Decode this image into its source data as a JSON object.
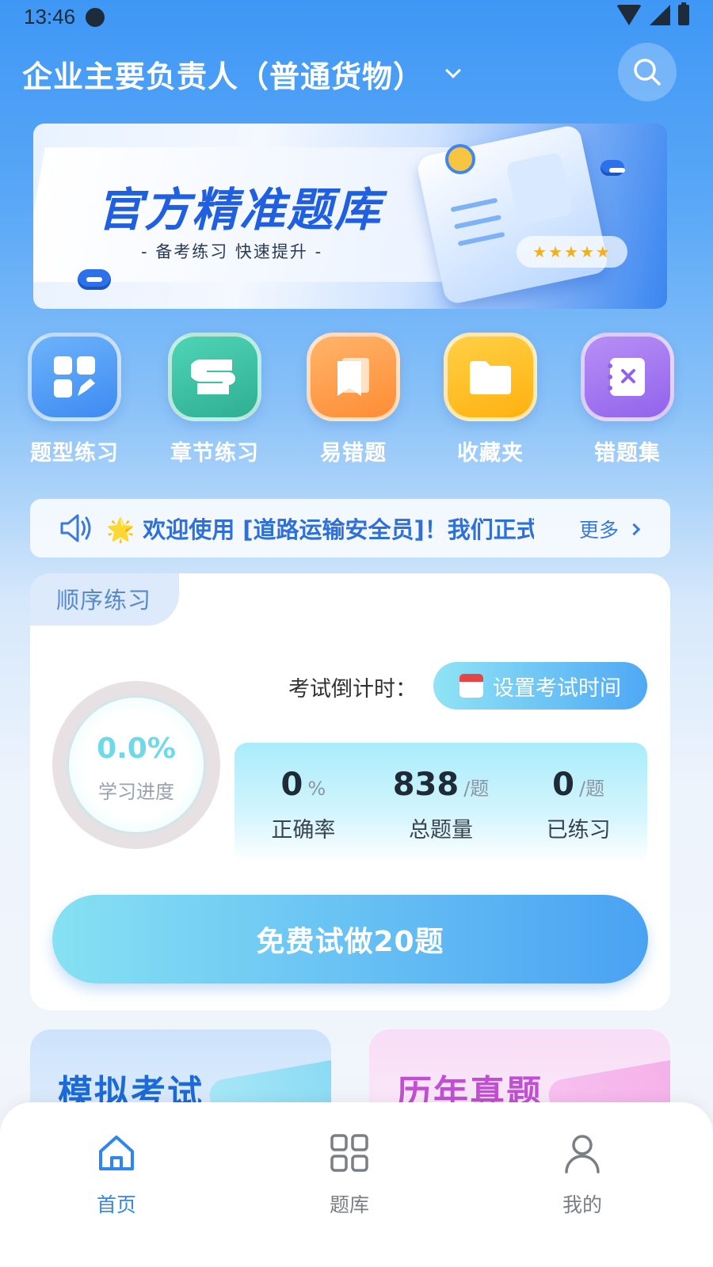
{
  "status_bar": {
    "time": "13:46"
  },
  "header": {
    "title": "企业主要负责人（普通货物）"
  },
  "banner": {
    "title": "官方精准题库",
    "subtitle": "-  备考练习  快速提升  -",
    "stars": "★★★★★"
  },
  "quick_nav": [
    {
      "label": "题型练习",
      "icon": "grid-edit-icon",
      "color": "#4f9df5"
    },
    {
      "label": "章节练习",
      "icon": "chapter-icon",
      "color": "#3cc2a6"
    },
    {
      "label": "易错题",
      "icon": "bookmark-icon",
      "color": "#ff9e45"
    },
    {
      "label": "收藏夹",
      "icon": "folder-icon",
      "color": "#ffbf1f"
    },
    {
      "label": "错题集",
      "icon": "wrong-notebook-icon",
      "color": "#a178f0"
    }
  ],
  "notice": {
    "text": "🌟 欢迎使用 [道路运输安全员]！我们正式",
    "more": "更多"
  },
  "practice": {
    "tab": "顺序练习",
    "progress_value": "0.0%",
    "progress_label": "学习进度",
    "countdown_label": "考试倒计时：",
    "countdown_button": "设置考试时间",
    "stats": [
      {
        "value": "0",
        "unit": "%",
        "label": "正确率"
      },
      {
        "value": "838",
        "unit": "/题",
        "label": "总题量"
      },
      {
        "value": "0",
        "unit": "/题",
        "label": "已练习"
      }
    ],
    "start_button": "免费试做20题"
  },
  "features": {
    "mock_exam": "模拟考试",
    "past_papers": "历年真题"
  },
  "bottom_nav": [
    {
      "label": "首页",
      "icon": "home-icon",
      "active": true
    },
    {
      "label": "题库",
      "icon": "grid-icon",
      "active": false
    },
    {
      "label": "我的",
      "icon": "user-icon",
      "active": false
    }
  ],
  "colors": {
    "primary": "#2f86ee",
    "banner_title": "#1f5fe0"
  }
}
